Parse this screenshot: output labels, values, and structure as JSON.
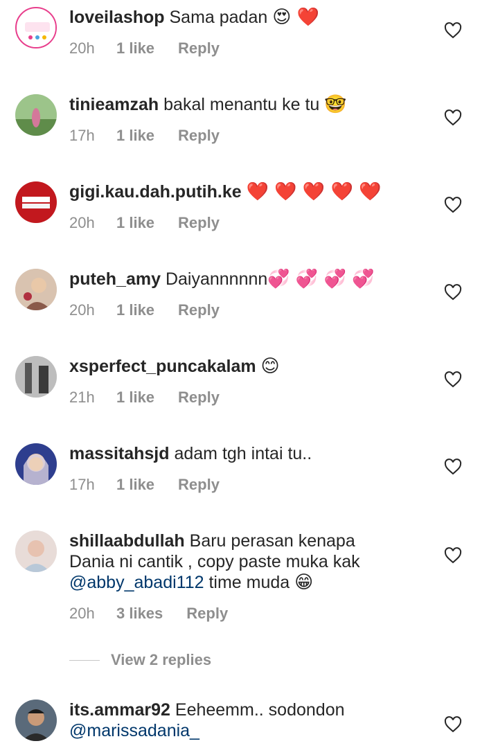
{
  "comments": [
    {
      "username": "loveilashop",
      "text": "Sama padan",
      "emoji": "😍 ❤️",
      "time": "20h",
      "likes": "1 like",
      "reply": "Reply",
      "avatar_color": "#ffffff",
      "accent": "#e83e8c"
    },
    {
      "username": "tinieamzah",
      "text": "bakal menantu ke tu",
      "emoji": "🤓",
      "time": "17h",
      "likes": "1 like",
      "reply": "Reply",
      "avatar_color": "#6d9b5a"
    },
    {
      "username": "gigi.kau.dah.putih.ke",
      "text": "",
      "emoji": "❤️ ❤️ ❤️ ❤️ ❤️",
      "time": "20h",
      "likes": "1 like",
      "reply": "Reply",
      "avatar_color": "#c2181e"
    },
    {
      "username": "puteh_amy",
      "text": "Daiyannnnnn",
      "emoji": "💞 💞 💞 💞",
      "time": "20h",
      "likes": "1 like",
      "reply": "Reply",
      "avatar_color": "#b98a6a"
    },
    {
      "username": "xsperfect_puncakalam",
      "text": "",
      "emoji": "😊",
      "time": "21h",
      "likes": "1 like",
      "reply": "Reply",
      "avatar_color": "#8a8a8a"
    },
    {
      "username": "massitahsjd",
      "text": "adam tgh intai tu..",
      "emoji": "",
      "time": "17h",
      "likes": "1 like",
      "reply": "Reply",
      "avatar_color": "#3a4a9a"
    },
    {
      "username": "shillaabdullah",
      "line1": "Baru perasan kenapa",
      "line2": "Dania ni cantik , copy paste muka kak",
      "mention": "@abby_abadi112",
      "line3_rest": "time muda",
      "emoji": "😁",
      "time": "20h",
      "likes": "3 likes",
      "reply": "Reply",
      "avatar_color": "#c9a9a0"
    },
    {
      "username": "its.ammar92",
      "text": "Eeheemm.. sodondon",
      "mention": "@marissadania_",
      "avatar_color": "#4a5a6a"
    }
  ],
  "view_replies": "View 2 replies",
  "colors": {
    "meta": "#8e8e8e",
    "mention": "#00376b",
    "text": "#262626"
  },
  "icons": {
    "like": "heart-outline-icon"
  }
}
